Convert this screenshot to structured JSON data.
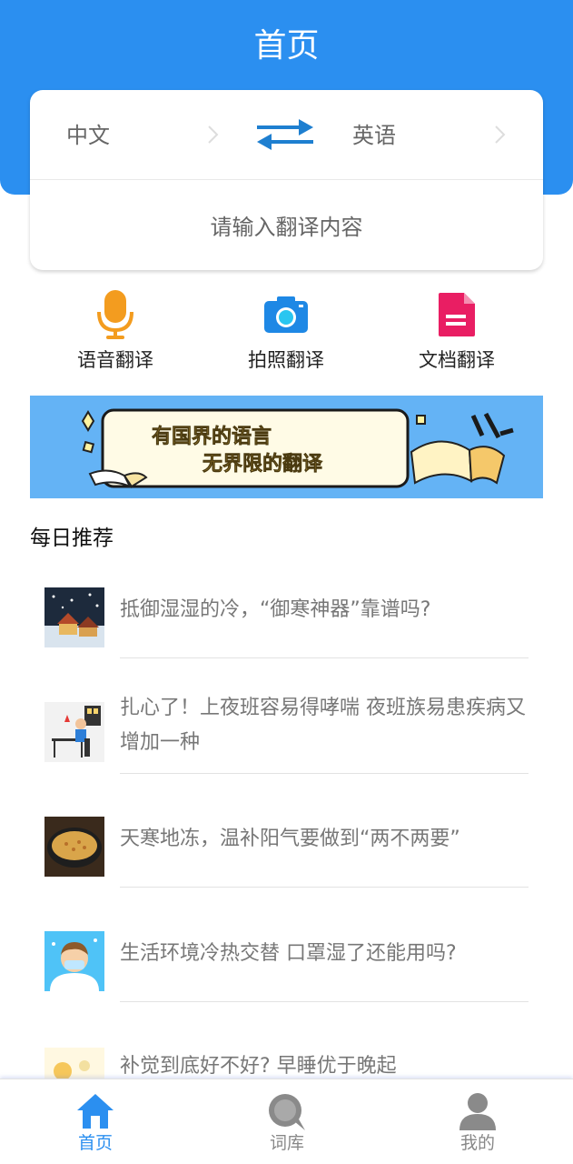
{
  "header": {
    "title": "首页"
  },
  "translator": {
    "source_lang": "中文",
    "target_lang": "英语",
    "input_placeholder": "请输入翻译内容"
  },
  "features": [
    {
      "label": "语音翻译",
      "icon": "microphone-icon"
    },
    {
      "label": "拍照翻译",
      "icon": "camera-icon"
    },
    {
      "label": "文档翻译",
      "icon": "document-icon"
    }
  ],
  "banner": {
    "line1": "有国界的语言",
    "line2": "无界限的翻译"
  },
  "daily": {
    "title": "每日推荐",
    "items": [
      {
        "title": "抵御湿湿的冷，“御寒神器”靠谱吗?"
      },
      {
        "title": "扎心了！上夜班容易得哮喘 夜班族易患疾病又增加一种"
      },
      {
        "title": "天寒地冻，温补阳气要做到“两不两要”"
      },
      {
        "title": "生活环境冷热交替 口罩湿了还能用吗?"
      },
      {
        "title": "补觉到底好不好? 早睡优于晚起"
      }
    ]
  },
  "tabbar": {
    "items": [
      {
        "label": "首页",
        "icon": "home-icon"
      },
      {
        "label": "词库",
        "icon": "search-icon"
      },
      {
        "label": "我的",
        "icon": "user-icon"
      }
    ]
  },
  "colors": {
    "primary": "#2b8ff0",
    "mic": "#f39c1f",
    "camera": "#1e88e5",
    "document": "#e91e63"
  }
}
